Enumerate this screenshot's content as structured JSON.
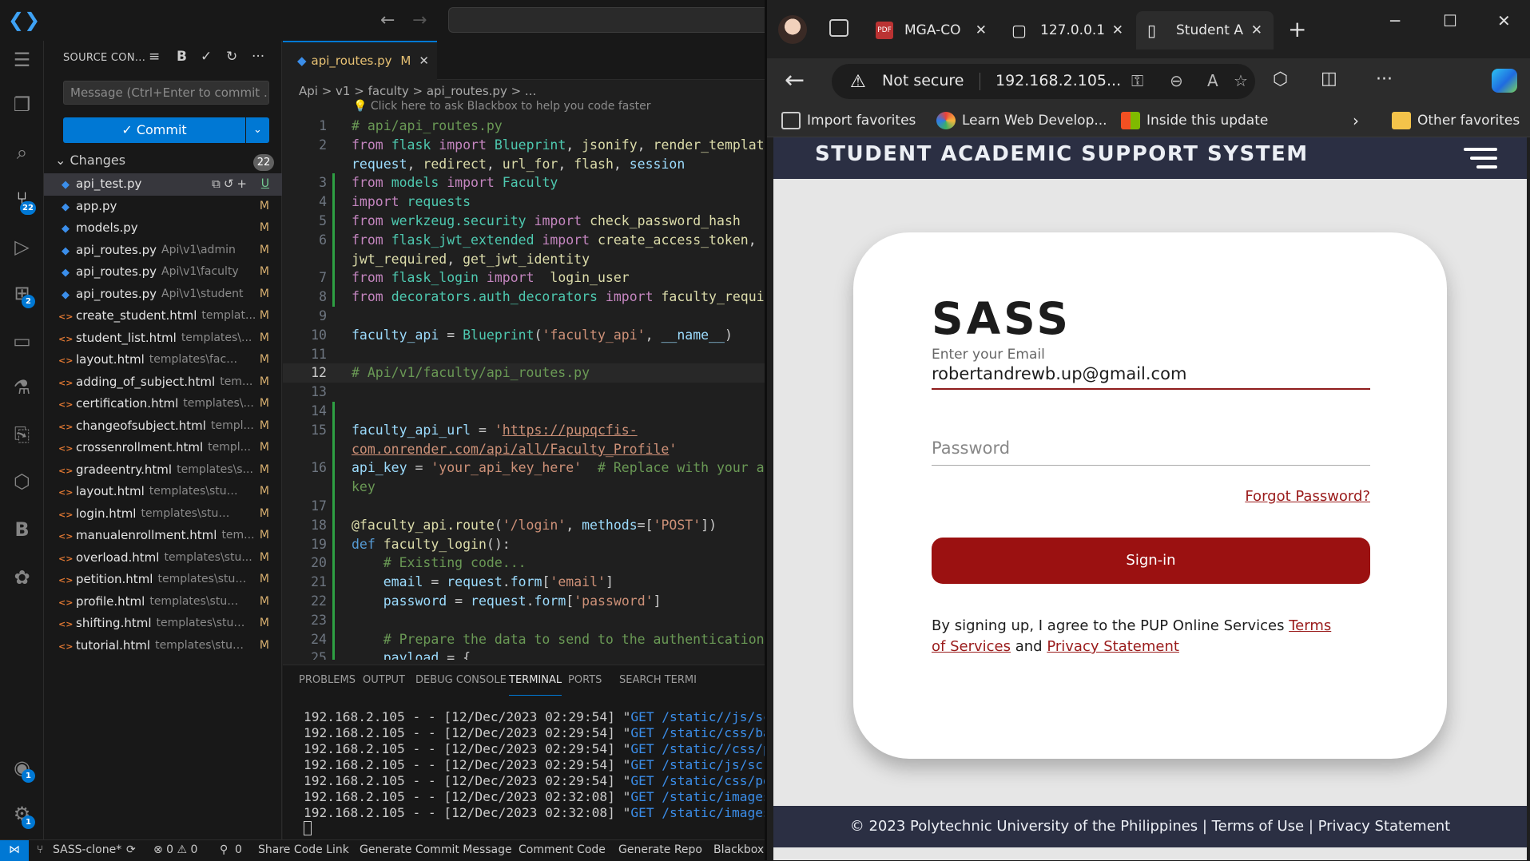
{
  "vscode": {
    "sidebar": {
      "title": "SOURCE CON...",
      "commit_placeholder": "Message (Ctrl+Enter to commit ...",
      "commit_label": "✓ Commit",
      "changes_label": "Changes",
      "changes_count": "22",
      "files": [
        {
          "name": "api_test.py",
          "path": "",
          "status": "U",
          "type": "py"
        },
        {
          "name": "app.py",
          "path": "",
          "status": "M",
          "type": "py"
        },
        {
          "name": "models.py",
          "path": "",
          "status": "M",
          "type": "py"
        },
        {
          "name": "api_routes.py",
          "path": "Api\\v1\\admin",
          "status": "M",
          "type": "py"
        },
        {
          "name": "api_routes.py",
          "path": "Api\\v1\\faculty",
          "status": "M",
          "type": "py"
        },
        {
          "name": "api_routes.py",
          "path": "Api\\v1\\student",
          "status": "M",
          "type": "py"
        },
        {
          "name": "create_student.html",
          "path": "templat...",
          "status": "M",
          "type": "html"
        },
        {
          "name": "student_list.html",
          "path": "templates\\...",
          "status": "M",
          "type": "html"
        },
        {
          "name": "layout.html",
          "path": "templates\\faculty",
          "status": "M",
          "type": "html"
        },
        {
          "name": "adding_of_subject.html",
          "path": "tem...",
          "status": "M",
          "type": "html"
        },
        {
          "name": "certification.html",
          "path": "templates\\...",
          "status": "M",
          "type": "html"
        },
        {
          "name": "changeofsubject.html",
          "path": "templ...",
          "status": "M",
          "type": "html"
        },
        {
          "name": "crossenrollment.html",
          "path": "templ...",
          "status": "M",
          "type": "html"
        },
        {
          "name": "gradeentry.html",
          "path": "templates\\s...",
          "status": "M",
          "type": "html"
        },
        {
          "name": "layout.html",
          "path": "templates\\student",
          "status": "M",
          "type": "html"
        },
        {
          "name": "login.html",
          "path": "templates\\student",
          "status": "M",
          "type": "html"
        },
        {
          "name": "manualenrollment.html",
          "path": "tem...",
          "status": "M",
          "type": "html"
        },
        {
          "name": "overload.html",
          "path": "templates\\stu...",
          "status": "M",
          "type": "html"
        },
        {
          "name": "petition.html",
          "path": "templates\\stud...",
          "status": "M",
          "type": "html"
        },
        {
          "name": "profile.html",
          "path": "templates\\student",
          "status": "M",
          "type": "html"
        },
        {
          "name": "shifting.html",
          "path": "templates\\stud...",
          "status": "M",
          "type": "html"
        },
        {
          "name": "tutorial.html",
          "path": "templates\\stude...",
          "status": "M",
          "type": "html"
        }
      ]
    },
    "editor": {
      "tab_label": "api_routes.py",
      "tab_status": "M",
      "breadcrumb": "Api  >  v1  >  faculty  >    api_routes.py  >  ...",
      "hint": "💡 Click here to ask Blackbox to help you code faster",
      "lines": [
        {
          "n": "1",
          "html": "<span class='c'># api/api_routes.py</span>"
        },
        {
          "n": "2",
          "html": "<span class='k'>from</span> <span class='n'>flask</span> <span class='k'>import</span> <span class='n'>Blueprint</span>, <span class='f'>jsonify</span>, <span class='f'>render_template</span>,"
        },
        {
          "n": "",
          "html": "<span class='v'>request</span>, <span class='f'>redirect</span>, <span class='f'>url_for</span>, <span class='f'>flash</span>, <span class='v'>session</span>"
        },
        {
          "n": "3",
          "html": "<span class='k'>from</span> <span class='n'>models</span> <span class='k'>import</span> <span class='n'>Faculty</span>"
        },
        {
          "n": "4",
          "html": "<span class='k'>import</span> <span class='n'>requests</span>"
        },
        {
          "n": "5",
          "html": "<span class='k'>from</span> <span class='n'>werkzeug.security</span> <span class='k'>import</span> <span class='f'>check_password_hash</span>"
        },
        {
          "n": "6",
          "html": "<span class='k'>from</span> <span class='n'>flask_jwt_extended</span> <span class='k'>import</span> <span class='f'>create_access_token</span>,"
        },
        {
          "n": "",
          "html": "<span class='f'>jwt_required</span>, <span class='f'>get_jwt_identity</span>"
        },
        {
          "n": "7",
          "html": "<span class='k'>from</span> <span class='n'>flask_login</span> <span class='k'>import</span>  <span class='f'>login_user</span>"
        },
        {
          "n": "8",
          "html": "<span class='k'>from</span> <span class='n'>decorators.auth_decorators</span> <span class='k'>import</span> <span class='f'>faculty_require</span>"
        },
        {
          "n": "9",
          "html": ""
        },
        {
          "n": "10",
          "html": "<span class='v'>faculty_api</span> = <span class='n'>Blueprint</span>(<span class='s'>'faculty_api'</span>, <span class='v'>__name__</span>)"
        },
        {
          "n": "11",
          "html": ""
        },
        {
          "n": "12",
          "html": "<span class='c'># Api/v1/faculty/api_routes.py</span>"
        },
        {
          "n": "13",
          "html": ""
        },
        {
          "n": "14",
          "html": ""
        },
        {
          "n": "15",
          "html": "<span class='v'>faculty_api_url</span> = <span class='s'>'</span><span class='u'>https://pupqcfis-</span>"
        },
        {
          "n": "",
          "html": "<span class='u'>com.onrender.com/api/all/Faculty_Profile</span><span class='s'>'</span>"
        },
        {
          "n": "16",
          "html": "<span class='v'>api_key</span> = <span class='s'>'your_api_key_here'</span>  <span class='c'># Replace with your act</span>"
        },
        {
          "n": "",
          "html": "<span class='c'>key</span>"
        },
        {
          "n": "17",
          "html": ""
        },
        {
          "n": "18",
          "html": "<span class='f'>@faculty_api.route</span>(<span class='s'>'/login'</span>, <span class='v'>methods</span>=[<span class='s'>'POST'</span>])"
        },
        {
          "n": "19",
          "html": "<span class='k2'>def</span> <span class='f'>faculty_login</span>():"
        },
        {
          "n": "20",
          "html": "    <span class='c'># Existing code...</span>"
        },
        {
          "n": "21",
          "html": "    <span class='v'>email</span> = <span class='v'>request</span>.<span class='v'>form</span>[<span class='s'>'email'</span>]"
        },
        {
          "n": "22",
          "html": "    <span class='v'>password</span> = <span class='v'>request</span>.<span class='v'>form</span>[<span class='s'>'password'</span>]"
        },
        {
          "n": "23",
          "html": ""
        },
        {
          "n": "24",
          "html": "    <span class='c'># Prepare the data to send to the authentication e</span>"
        },
        {
          "n": "25",
          "html": "    <span class='v'>payload</span> = {"
        }
      ]
    },
    "panel": {
      "tabs": [
        "PROBLEMS",
        "OUTPUT",
        "DEBUG CONSOLE",
        "TERMINAL",
        "PORTS",
        "SEARCH TERMI"
      ],
      "terminal_lines": [
        {
          "pre": "192.168.2.105 - - [12/Dec/2023 02:29:54] \"",
          "get": "GET /static//js/script"
        },
        {
          "pre": "192.168.2.105 - - [12/Dec/2023 02:29:54] \"",
          "get": "GET /static/css/base.c"
        },
        {
          "pre": "192.168.2.105 - - [12/Dec/2023 02:29:54] \"",
          "get": "GET /static//css/porta"
        },
        {
          "pre": "192.168.2.105 - - [12/Dec/2023 02:29:54] \"",
          "get": "GET /static/js/script."
        },
        {
          "pre": "192.168.2.105 - - [12/Dec/2023 02:29:54] \"",
          "get": "GET /static/css/portal"
        },
        {
          "pre": "192.168.2.105 - - [12/Dec/2023 02:32:08] \"",
          "get": "GET /static/images/clo"
        },
        {
          "pre": "192.168.2.105 - - [12/Dec/2023 02:32:08] \"",
          "get": "GET /static/images/men"
        }
      ]
    },
    "statusbar": {
      "branch": "SASS-clone*",
      "problems": "⊗ 0 ⚠ 0",
      "ports": "0",
      "items": [
        "Share Code Link",
        "Generate Commit Message",
        "Comment Code",
        "Generate Repo",
        "Blackbox"
      ]
    },
    "badges": {
      "scm": "22",
      "extensions": "2",
      "accounts": "1",
      "settings": "1"
    }
  },
  "edge": {
    "tabs": [
      {
        "label": "MGA-CO"
      },
      {
        "label": "127.0.0.1"
      },
      {
        "label": "Student A"
      }
    ],
    "address": {
      "security": "Not secure",
      "url": "192.168.2.105..."
    },
    "favorites": [
      "Import favorites",
      "Learn Web Develop...",
      "Inside this update",
      "Other favorites"
    ]
  },
  "page": {
    "header_title": "STUDENT ACADEMIC SUPPORT SYSTEM",
    "brand": "SASS",
    "email_label": "Enter your Email",
    "email_value": "robertandrewb.up@gmail.com",
    "password_placeholder": "Password",
    "forgot": "Forgot Password?",
    "signin": "Sign-in",
    "terms_prefix": "By signing up, I agree to the PUP Online Services",
    "terms_link": "Terms of Services",
    "terms_and": "and",
    "privacy_link": "Privacy Statement",
    "footer": "© 2023 Polytechnic University of the Philippines | Terms of Use | Privacy Statement"
  },
  "colors": {
    "vscode_accent": "#0078d4",
    "sass_red": "#9b1111",
    "sass_header": "#2b2f43"
  }
}
